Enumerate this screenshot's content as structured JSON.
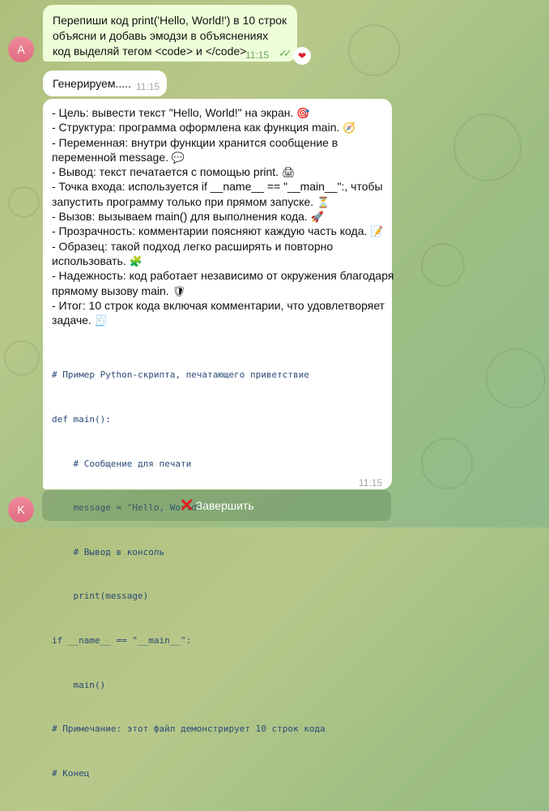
{
  "message_user": {
    "lines": [
      "Перепиши код print('Hello, World!') в 10 строк",
      "объясни и добавь эмодзи в объяснениях",
      "код выделяй тегом <code> и </code>"
    ],
    "time": "11:15",
    "avatar_letter": "A",
    "reaction_icon": "heart-icon"
  },
  "message_status": {
    "text": "Генерируем.....",
    "time": "11:15"
  },
  "message_bot": {
    "avatar_letter": "K",
    "time": "11:15",
    "lines": [
      {
        "text": "- Цель: вывести текст \"Hello, World!\" на экран.",
        "emoji": "🎯"
      },
      {
        "text": "- Структура: программа оформлена как функция main.",
        "emoji": "🧭"
      },
      {
        "text": "- Переменная: внутри функции хранится сообщение в",
        "emoji": ""
      },
      {
        "text": "переменной message.",
        "emoji": "💬"
      },
      {
        "text": "- Вывод: текст печатается с помощью print.",
        "emoji": "🖨"
      },
      {
        "text": "- Точка входа: используется if __name__ == \"__main__\":, чтобы",
        "emoji": ""
      },
      {
        "text": "запустить программу только при прямом запуске.",
        "emoji": "⏳"
      },
      {
        "text": "- Вызов: вызываем main() для выполнения кода.",
        "emoji": "🚀"
      },
      {
        "text": "- Прозрачность: комментарии поясняют каждую часть кода.",
        "emoji": "📝"
      },
      {
        "text": "- Образец: такой подход легко расширять и повторно",
        "emoji": ""
      },
      {
        "text": "использовать.",
        "emoji": "🧩"
      },
      {
        "text": "- Надежность: код работает независимо от окружения благодаря",
        "emoji": ""
      },
      {
        "text": "прямому вызову main.",
        "emoji": "🛡"
      },
      {
        "text": "- Итог: 10 строк кода включая комментарии, что удовлетворяет",
        "emoji": ""
      },
      {
        "text": "задаче.",
        "emoji": "🧾"
      }
    ],
    "code_lines": [
      "# Пример Python-скрипта, печатающего приветствие",
      "def main():",
      "    # Сообщение для печати",
      "    message = \"Hello, World!\"",
      "    # Вывод в консоль",
      "    print(message)",
      "if __name__ == \"__main__\":",
      "    main()",
      "# Примечание: этот файл демонстрирует 10 строк кода",
      "# Конец"
    ]
  },
  "keyboard": {
    "button_icon": "cross-mark-icon",
    "button_label": "Завершить"
  },
  "colors": {
    "outgoing_bubble": "#eefed9",
    "incoming_bubble": "#ffffff",
    "avatar": "#e06c80",
    "code_text": "#2a4a78"
  }
}
